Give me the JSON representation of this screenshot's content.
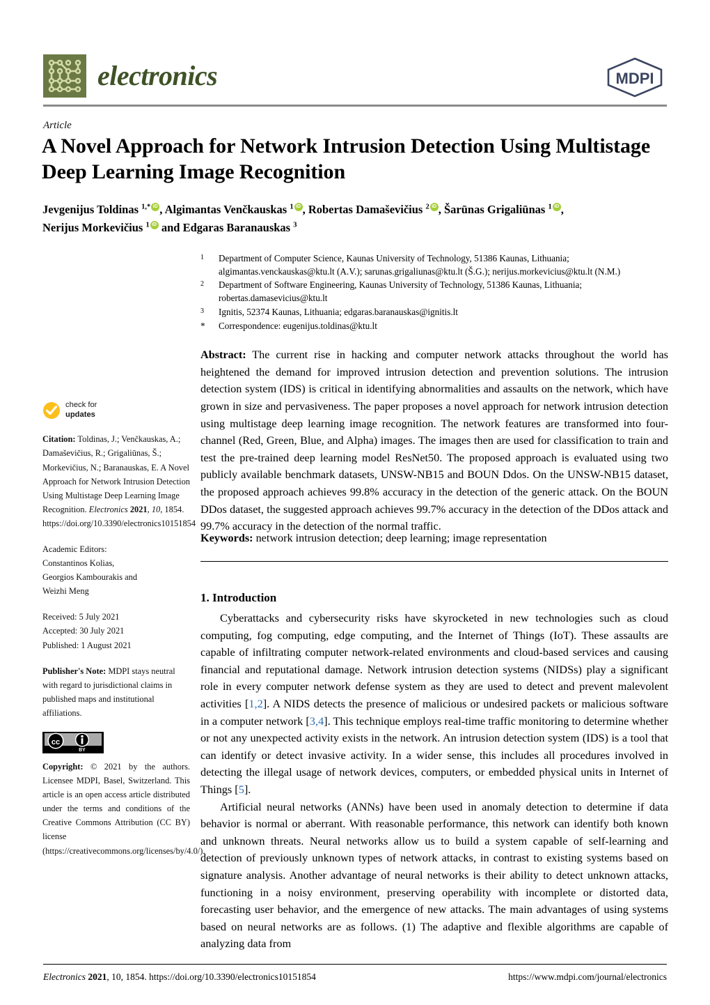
{
  "journal": {
    "name": "electronics",
    "publisher_logo_text": "MDPI",
    "logo_icon": "circuit-board-icon"
  },
  "article": {
    "type_label": "Article",
    "title": "A Novel Approach for Network Intrusion Detection Using Multistage Deep Learning Image Recognition"
  },
  "authors": {
    "line1_part1": "Jevgenijus Toldinas ",
    "line1_sup1": "1,*",
    "line1_part2": ", Algimantas Venčkauskas ",
    "line1_sup2": "1",
    "line1_part3": ", Robertas Damaševičius ",
    "line1_sup3": "2",
    "line1_part4": ", Šarūnas Grigaliūnas ",
    "line1_sup4": "1",
    "line1_part5": ",",
    "line2_part1": "Nerijus Morkevičius ",
    "line2_sup1": "1",
    "line2_part2": " and Edgaras Baranauskas ",
    "line2_sup2": "3"
  },
  "affiliations": [
    {
      "marker": "1",
      "text": "Department of Computer Science, Kaunas University of Technology, 51386 Kaunas, Lithuania; algimantas.venckauskas@ktu.lt (A.V.); sarunas.grigaliunas@ktu.lt (Š.G.); nerijus.morkevicius@ktu.lt (N.M.)"
    },
    {
      "marker": "2",
      "text": "Department of Software Engineering, Kaunas University of Technology, 51386 Kaunas, Lithuania; robertas.damasevicius@ktu.lt"
    },
    {
      "marker": "3",
      "text": "Ignitis, 52374 Kaunas, Lithuania; edgaras.baranauskas@ignitis.lt"
    },
    {
      "marker": "*",
      "text": "Correspondence: eugenijus.toldinas@ktu.lt"
    }
  ],
  "abstract": {
    "label": "Abstract:",
    "text": " The current rise in hacking and computer network attacks throughout the world has heightened the demand for improved intrusion detection and prevention solutions. The intrusion detection system (IDS) is critical in identifying abnormalities and assaults on the network, which have grown in size and pervasiveness. The paper proposes a novel approach for network intrusion detection using multistage deep learning image recognition. The network features are transformed into four-channel (Red, Green, Blue, and Alpha) images. The images then are used for classification to train and test the pre-trained deep learning model ResNet50. The proposed approach is evaluated using two publicly available benchmark datasets, UNSW-NB15 and BOUN Ddos. On the UNSW-NB15 dataset, the proposed approach achieves 99.8% accuracy in the detection of the generic attack. On the BOUN DDos dataset, the suggested approach achieves 99.7% accuracy in the detection of the DDos attack and 99.7% accuracy in the detection of the normal traffic."
  },
  "keywords": {
    "label": "Keywords:",
    "text": " network intrusion detection; deep learning; image representation"
  },
  "sidebar": {
    "check_for_updates": {
      "line1": "check for",
      "line2": "updates",
      "icon": "check-circle-icon"
    },
    "citation": {
      "label": "Citation:",
      "text": " Toldinas, J.; Venčkauskas, A.; Damaševičius, R.; Grigaliūnas, Š.; Morkevičius, N.; Baranauskas, E. A Novel Approach for Network Intrusion Detection Using Multistage Deep Learning Image Recognition. ",
      "journal": "Electronics",
      "year": " 2021",
      "volume": ", 10",
      "pages": ", 1854.",
      "doi": "https://doi.org/10.3390/electronics10151854"
    },
    "editors": {
      "label": "Academic Editors:",
      "names": [
        "Constantinos Kolias,",
        "Georgios Kambourakis and",
        "Weizhi Meng"
      ]
    },
    "dates": {
      "received": "Received: 5 July 2021",
      "accepted": "Accepted: 30 July 2021",
      "published": "Published: 1 August 2021"
    },
    "publisher_note": {
      "label": "Publisher's Note:",
      "text": " MDPI stays neutral with regard to jurisdictional claims in published maps and institutional affiliations."
    },
    "license_badge": {
      "cc": "cc",
      "by": "BY",
      "icon": "creative-commons-icon"
    },
    "copyright": {
      "label": "Copyright:",
      "text": " © 2021 by the authors. Licensee MDPI, Basel, Switzerland. This article is an open access article distributed under the terms and conditions of the Creative Commons Attribution (CC BY) license (https://creativecommons.org/licenses/by/4.0/)."
    }
  },
  "introduction": {
    "heading": "1. Introduction",
    "para1_a": "Cyberattacks and cybersecurity risks have skyrocketed in new technologies such as cloud computing, fog computing, edge computing, and the Internet of Things (IoT). These assaults are capable of infiltrating computer network-related environments and cloud-based services and causing financial and reputational damage. Network intrusion detection systems (NIDSs) play a significant role in every computer network defense system as they are used to detect and prevent malevolent activities [",
    "ref1": "1,2",
    "para1_b": "]. A NIDS detects the presence of malicious or undesired packets or malicious software in a computer network [",
    "ref2": "3,4",
    "para1_c": "]. This technique employs real-time traffic monitoring to determine whether or not any unexpected activity exists in the network. An intrusion detection system (IDS) is a tool that can identify or detect invasive activity.  In a wider sense, this includes all procedures involved in detecting the illegal usage of network devices, computers, or embedded physical units in Internet of Things [",
    "ref3": "5",
    "para1_d": "].",
    "para2": "Artificial neural networks (ANNs) have been used in anomaly detection to determine if data behavior is normal or aberrant.  With reasonable performance, this network can identify both known and unknown threats. Neural networks allow us to build a system capable of self-learning and detection of previously unknown types of network attacks, in contrast to existing systems based on signature analysis. Another advantage of neural networks is their ability to detect unknown attacks, functioning in a noisy environment, preserving operability with incomplete or distorted data, forecasting user behavior, and the emergence of new attacks. The main advantages of using systems based on neural networks are as follows. (1) The adaptive and flexible algorithms are capable of analyzing data from"
  },
  "footer": {
    "left_journal": "Electronics",
    "left_year": " 2021",
    "left_rest": ", 10, 1854. https://doi.org/10.3390/electronics10151854",
    "right": "https://www.mdpi.com/journal/electronics"
  },
  "colors": {
    "journal_green": "#3f5227",
    "logo_green": "#6b7a45",
    "mdpi_navy": "#3b4560",
    "orcid_green": "#a6ce39",
    "check_yellow": "#fcbf1b",
    "citation_link": "#2b6fb5"
  }
}
